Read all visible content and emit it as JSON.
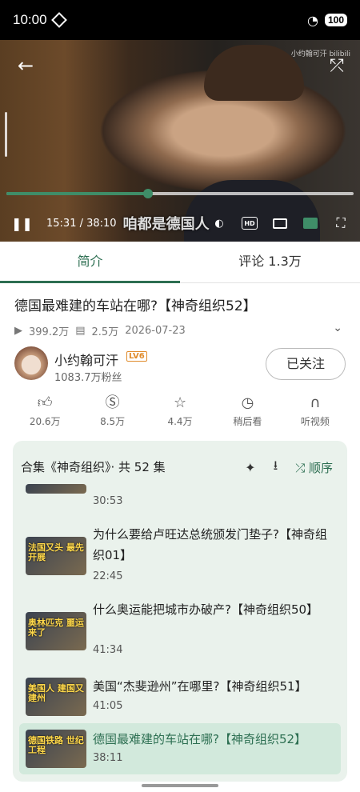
{
  "status": {
    "time": "10:00",
    "battery": "100"
  },
  "player": {
    "watermark": "小约翰可汗 bilibili",
    "time": "15:31 / 38:10",
    "progress": 0.407,
    "subtitle": "咱都是德国人",
    "hd_label": "HD"
  },
  "tabs": [
    {
      "label": "简介"
    },
    {
      "label": "评论 1.3万"
    }
  ],
  "video": {
    "title": "德国最难建的车站在哪?【神奇组织52】",
    "views": "399.2万",
    "danmaku": "2.5万",
    "date": "2026-07-23"
  },
  "author": {
    "name": "小约翰可汗",
    "level": "LV6",
    "fans": "1083.7万粉丝",
    "follow_label": "已关注"
  },
  "actions": [
    {
      "icon": "thumb-up-icon",
      "label": "20.6万"
    },
    {
      "icon": "coin-icon",
      "label": "8.5万"
    },
    {
      "icon": "star-icon",
      "label": "4.4万"
    },
    {
      "icon": "clock-icon",
      "label": "稍后看"
    },
    {
      "icon": "headphones-icon",
      "label": "听视频"
    }
  ],
  "playlist": {
    "header": "合集《神奇组织》· 共 52 集",
    "order_label": "顺序",
    "episodes": [
      {
        "title": "",
        "duration": "30:53",
        "thumb_text": ""
      },
      {
        "title": "为什么要给卢旺达总统颁发门垫子?【神奇组织01】",
        "duration": "22:45",
        "thumb_text": "法国又头 最先开展"
      },
      {
        "title": "什么奥运能把城市办破产?【神奇组织50】",
        "duration": "41:34",
        "thumb_text": "奥林匹克 噩运来了"
      },
      {
        "title": "美国“杰斐逊州”在哪里?【神奇组织51】",
        "duration": "41:05",
        "thumb_text": "美国人 建国又建州"
      },
      {
        "title": "德国最难建的车站在哪?【神奇组织52】",
        "duration": "38:11",
        "thumb_text": "德国铁路 世纪工程"
      }
    ]
  }
}
